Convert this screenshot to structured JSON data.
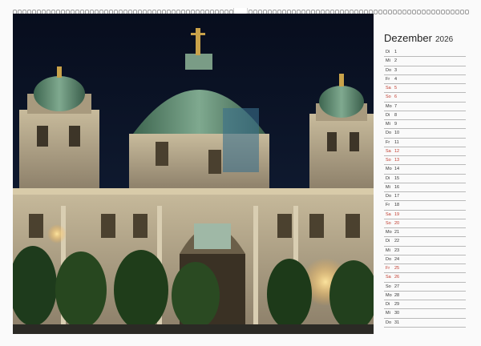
{
  "calendar": {
    "month": "Dezember",
    "year": "2026",
    "days": [
      {
        "wd": "Di",
        "d": "1",
        "weekend": false
      },
      {
        "wd": "Mi",
        "d": "2",
        "weekend": false
      },
      {
        "wd": "Do",
        "d": "3",
        "weekend": false
      },
      {
        "wd": "Fr",
        "d": "4",
        "weekend": false
      },
      {
        "wd": "Sa",
        "d": "5",
        "weekend": true
      },
      {
        "wd": "So",
        "d": "6",
        "weekend": true
      },
      {
        "wd": "Mo",
        "d": "7",
        "weekend": false
      },
      {
        "wd": "Di",
        "d": "8",
        "weekend": false
      },
      {
        "wd": "Mi",
        "d": "9",
        "weekend": false
      },
      {
        "wd": "Do",
        "d": "10",
        "weekend": false
      },
      {
        "wd": "Fr",
        "d": "11",
        "weekend": false
      },
      {
        "wd": "Sa",
        "d": "12",
        "weekend": true
      },
      {
        "wd": "So",
        "d": "13",
        "weekend": true
      },
      {
        "wd": "Mo",
        "d": "14",
        "weekend": false
      },
      {
        "wd": "Di",
        "d": "15",
        "weekend": false
      },
      {
        "wd": "Mi",
        "d": "16",
        "weekend": false
      },
      {
        "wd": "Do",
        "d": "17",
        "weekend": false
      },
      {
        "wd": "Fr",
        "d": "18",
        "weekend": false
      },
      {
        "wd": "Sa",
        "d": "19",
        "weekend": true
      },
      {
        "wd": "So",
        "d": "20",
        "weekend": true
      },
      {
        "wd": "Mo",
        "d": "21",
        "weekend": false
      },
      {
        "wd": "Di",
        "d": "22",
        "weekend": false
      },
      {
        "wd": "Mi",
        "d": "23",
        "weekend": false
      },
      {
        "wd": "Do",
        "d": "24",
        "weekend": false
      },
      {
        "wd": "Fr",
        "d": "25",
        "weekend": true
      },
      {
        "wd": "Sa",
        "d": "26",
        "weekend": true
      },
      {
        "wd": "So",
        "d": "27",
        "weekend": false
      },
      {
        "wd": "Mo",
        "d": "28",
        "weekend": false
      },
      {
        "wd": "Di",
        "d": "29",
        "weekend": false
      },
      {
        "wd": "Mi",
        "d": "30",
        "weekend": false
      },
      {
        "wd": "Do",
        "d": "31",
        "weekend": false
      }
    ]
  },
  "colors": {
    "weekend": "#c0392b",
    "sky": "#0b1428",
    "dome": "#5f8a72",
    "stone": "#b8a98c"
  },
  "photo": {
    "subject": "cathedral-night-photo"
  }
}
